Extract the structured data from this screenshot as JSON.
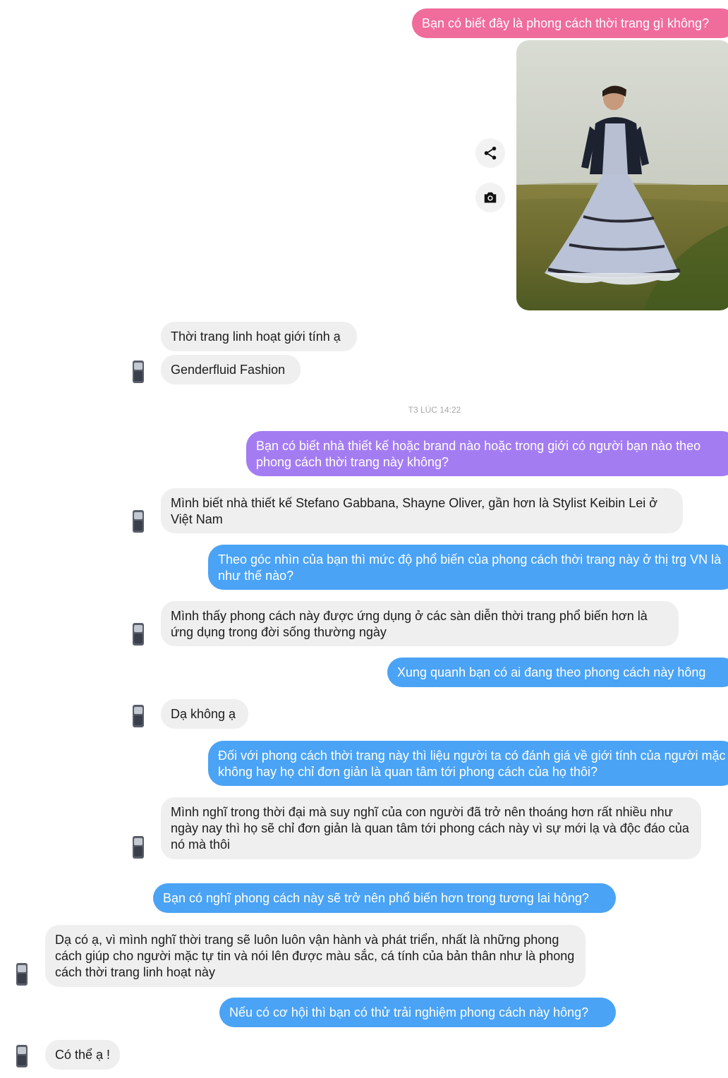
{
  "colors": {
    "pink": "#f06c9b",
    "purple": "#a47cf2",
    "blue": "#4aa3f5",
    "incoming_bg": "#efefef",
    "incoming_text": "#1c1c1c"
  },
  "conversation": {
    "q1": "Bạn có biết đây là phong cách thời trang gì không?",
    "a1_line1": "Thời trang linh hoạt giới tính ạ",
    "a1_line2": "Genderfluid Fashion",
    "timestamp": "T3 LÚC 14:22",
    "q2": "Bạn có biết nhà thiết kế hoặc brand nào hoặc trong giới có người bạn nào theo phong cách thời trang này không?",
    "a2": "Mình biết nhà thiết kế Stefano Gabbana, Shayne Oliver, gần hơn là Stylist Keibin Lei ở Việt Nam",
    "q3": "Theo góc nhìn của bạn thì mức độ phổ biến của phong cách thời trang này ở thị trg VN  là như thế nào?",
    "a3": "Mình thấy phong cách này được ứng dụng ở các sàn diễn thời trang phổ biến hơn là ứng dụng trong đời sống thường ngày",
    "q4": "Xung quanh bạn có ai đang theo phong cách này hông",
    "a4": "Dạ không ạ",
    "q5": "Đối với phong cách thời trang này thì liệu người ta có đánh giá về giới tính của người mặc không hay họ chỉ đơn giản là quan tâm tới phong cách của họ thôi?",
    "a5": "Mình nghĩ trong thời đại mà suy nghĩ của con người đã trở nên thoáng hơn rất nhiều như ngày nay thì họ sẽ chỉ đơn giản là quan tâm tới phong cách này vì sự mới lạ và độc đáo của nó mà thôi",
    "q6": "Bạn có nghĩ phong cách này sẽ trở nên phổ biến hơn trong tương lai hông?",
    "a6": "Dạ có ạ, vì mình nghĩ thời trang sẽ luôn luôn vận hành và phát triển, nhất là những phong cách giúp cho người mặc tự tin và nói lên được màu sắc, cá tính của bản thân như là phong cách thời trang linh hoạt này",
    "q7": "Nếu có cơ hội thì bạn có thử trải nghiệm phong cách này hông?",
    "a7": "Có thể ạ !"
  },
  "icons": {
    "share": "share-icon",
    "camera": "camera-icon",
    "avatar": "avatar-icon"
  }
}
